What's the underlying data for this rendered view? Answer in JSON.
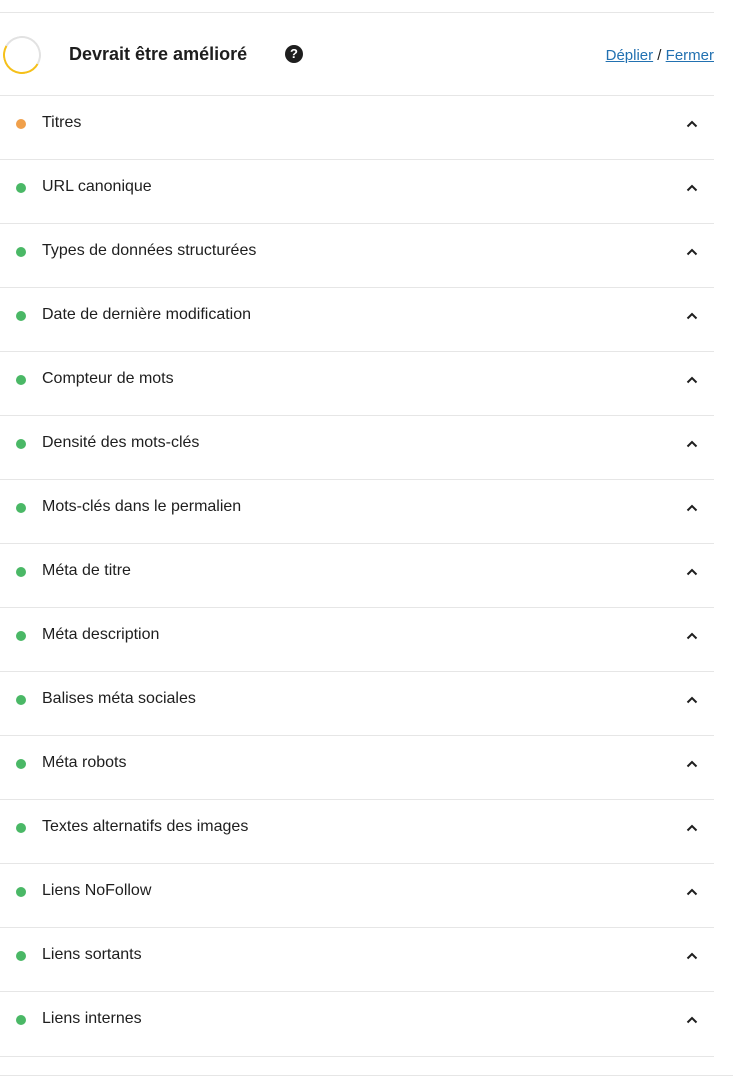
{
  "header": {
    "title": "Devrait être amélioré",
    "help_icon": "?",
    "expand_label": "Déplier",
    "separator": " / ",
    "collapse_label": "Fermer"
  },
  "colors": {
    "ring": "#f5c01a",
    "good": "#4ab866",
    "warning": "#f0a04b",
    "link": "#2271b1"
  },
  "items": [
    {
      "label": "Titres",
      "status": "warning",
      "icon": "chevron-up-icon"
    },
    {
      "label": "URL canonique",
      "status": "good",
      "icon": "chevron-up-icon"
    },
    {
      "label": "Types de données structurées",
      "status": "good",
      "icon": "chevron-up-icon"
    },
    {
      "label": "Date de dernière modification",
      "status": "good",
      "icon": "chevron-up-icon"
    },
    {
      "label": "Compteur de mots",
      "status": "good",
      "icon": "chevron-up-icon"
    },
    {
      "label": "Densité des mots-clés",
      "status": "good",
      "icon": "chevron-up-icon"
    },
    {
      "label": "Mots-clés dans le permalien",
      "status": "good",
      "icon": "chevron-up-icon"
    },
    {
      "label": "Méta de titre",
      "status": "good",
      "icon": "chevron-up-icon"
    },
    {
      "label": "Méta description",
      "status": "good",
      "icon": "chevron-up-icon"
    },
    {
      "label": "Balises méta sociales",
      "status": "good",
      "icon": "chevron-up-icon"
    },
    {
      "label": "Méta robots",
      "status": "good",
      "icon": "chevron-up-icon"
    },
    {
      "label": "Textes alternatifs des images",
      "status": "good",
      "icon": "chevron-up-icon"
    },
    {
      "label": "Liens NoFollow",
      "status": "good",
      "icon": "chevron-up-icon"
    },
    {
      "label": "Liens sortants",
      "status": "good",
      "icon": "chevron-up-icon"
    },
    {
      "label": "Liens internes",
      "status": "good",
      "icon": "chevron-up-icon"
    }
  ]
}
